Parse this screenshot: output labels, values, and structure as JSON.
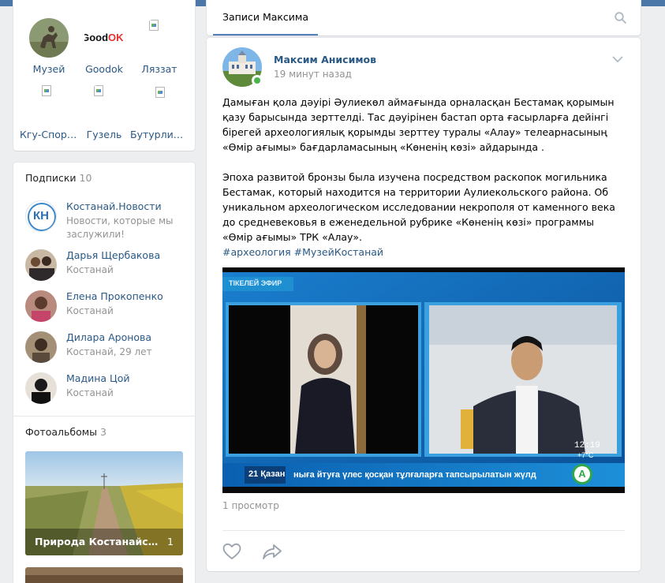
{
  "communities": [
    {
      "name": "Музей",
      "icon": "museum-avatar"
    },
    {
      "name": "Goodok",
      "icon": "goodok-logo",
      "logo_text": "GoodOK!"
    },
    {
      "name": "Ляззат",
      "icon": "broken-image-icon"
    },
    {
      "name": "Кгу-Спорт…",
      "icon": "broken-image-icon"
    },
    {
      "name": "Гузель",
      "icon": "broken-image-icon"
    },
    {
      "name": "Бутурлино…",
      "icon": "broken-image-icon"
    }
  ],
  "subscriptions": {
    "title": "Подписки",
    "count": "10",
    "items": [
      {
        "name": "Костанай.Новости",
        "subtitle": "Новости, которые мы заслужили!",
        "logo_text": "КН"
      },
      {
        "name": "Дарья Щербакова",
        "subtitle": "Костанай"
      },
      {
        "name": "Елена Прокопенко",
        "subtitle": "Костанай"
      },
      {
        "name": "Дилара Аронова",
        "subtitle": "Костанай, 29 лет"
      },
      {
        "name": "Мадина Цой",
        "subtitle": "Костанай"
      }
    ]
  },
  "albums": {
    "title": "Фотоальбомы",
    "count": "3",
    "items": [
      {
        "title": "Природа Костанайской о…",
        "count": "1"
      }
    ]
  },
  "wall": {
    "tab_label": "Записи Максима"
  },
  "post": {
    "author": "Максим Анисимов",
    "time": "19 минут назад",
    "text_kz": "Дамыған қола дәуірі Әулиекөл аймағында орналасқан Бестамақ қорымын қазу барысында зерттелді. Тас дәуірінен бастап орта ғасырларға дейінгі бірегей археологиялық қорымды зерттеу туралы «Алау» телеарнасының «Өмір ағымы» бағдарламасының «Көненің көзі» айдарында .",
    "text_ru": "Эпоха развитой бронзы была изучена посредством раскопок могильника Бестамак, который находится на территории Аулиекольского района. Об уникальном археологическом исследовании некрополя от каменного века до средневековья в еженедельной рубрике «Көненің көзі» программы «Өмір ағымы» ТРК «Алау».",
    "hashtags": "#археология #МузейКостанай",
    "views": "1 просмотр",
    "video": {
      "live_label": "ТІКЕЛЕЙ ЭФИР",
      "clock": "12:19",
      "temperature": "+7°C",
      "ticker_date": "21 Қазан",
      "ticker_text": "ныға йтуға үлес қосқан тұлғаларға тапсырылатын жүлд",
      "channel_logo": "A"
    }
  },
  "colors": {
    "accent": "#4a76a8",
    "link": "#2a5885",
    "muted": "#939393",
    "online": "#4bb34b"
  }
}
